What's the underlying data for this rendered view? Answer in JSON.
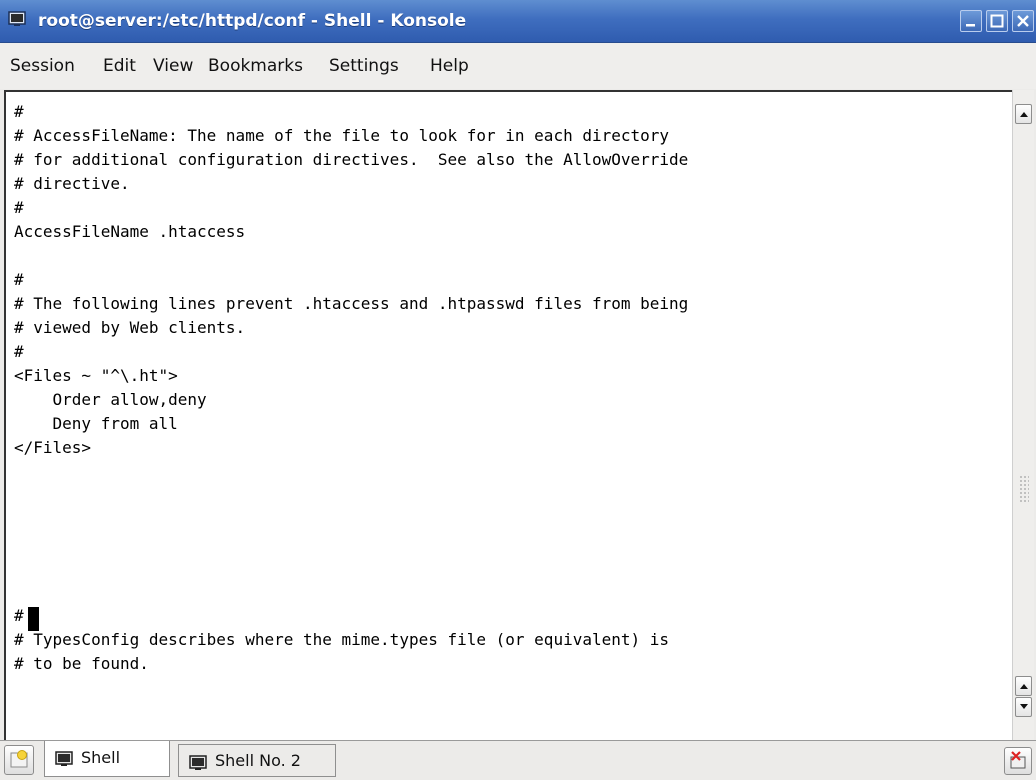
{
  "window": {
    "title": "root@server:/etc/httpd/conf - Shell - Konsole",
    "controls": {
      "minimize": "_",
      "maximize": "□",
      "close": "x"
    }
  },
  "menu": [
    "Session",
    "Edit",
    "View",
    "Bookmarks",
    "Settings",
    "Help"
  ],
  "terminal": {
    "lines": [
      "#",
      "# AccessFileName: The name of the file to look for in each directory",
      "# for additional configuration directives.  See also the AllowOverride",
      "# directive.",
      "#",
      "AccessFileName .htaccess",
      "",
      "#",
      "# The following lines prevent .htaccess and .htpasswd files from being",
      "# viewed by Web clients.",
      "#",
      "<Files ~ \"^\\.ht\">",
      "    Order allow,deny",
      "    Deny from all",
      "</Files>",
      "",
      "",
      "",
      "",
      "",
      "",
      "#",
      "# TypesConfig describes where the mime.types file (or equivalent) is",
      "# to be found."
    ]
  },
  "tabs": [
    {
      "label": "Shell",
      "active": true,
      "icon": "terminal-icon"
    },
    {
      "label": "Shell No. 2",
      "active": false,
      "icon": "terminal-icon"
    }
  ],
  "icons": {
    "window": "terminal-icon",
    "new_tab": "new-session-icon",
    "close_tab": "close-session-icon",
    "scroll_up": "arrow-up-icon",
    "scroll_down": "arrow-down-icon"
  },
  "colors": {
    "titlebar": "#3f6ebf",
    "terminal_bg": "#ffffff",
    "terminal_fg": "#000000"
  }
}
